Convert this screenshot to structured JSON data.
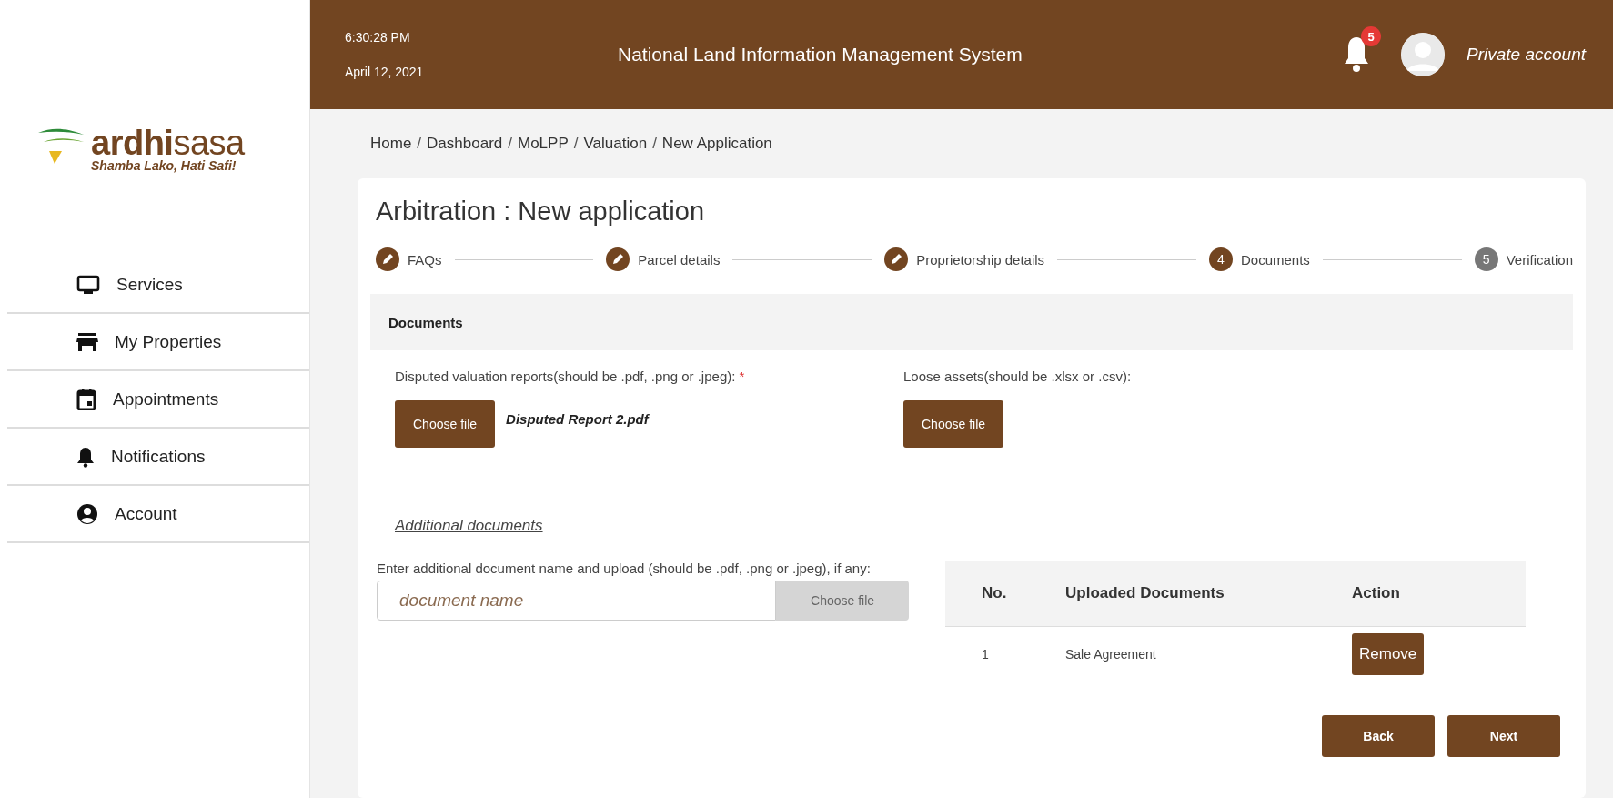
{
  "header": {
    "time": "6:30:28 PM",
    "date": "April 12, 2021",
    "title": "National Land Information Management System",
    "notification_count": "5",
    "account": "Private account"
  },
  "logo": {
    "name": "**ardhi**sasa",
    "tagline": "Shamba Lako, Hati Safi!"
  },
  "sidebar": {
    "items": [
      {
        "label": "Services",
        "kind": "monitor"
      },
      {
        "label": "My Properties",
        "kind": "store"
      },
      {
        "label": "Appointments",
        "kind": "calendar"
      },
      {
        "label": "Notifications",
        "kind": "bell"
      },
      {
        "label": "Account",
        "kind": "account"
      }
    ]
  },
  "breadcrumb": [
    "Home",
    "Dashboard",
    "MoLPP",
    "Valuation",
    "New Application"
  ],
  "breadcrumb_separator": "/",
  "page_title": "Arbitration : New application",
  "steps": [
    {
      "label": "FAQs",
      "kind": "done"
    },
    {
      "label": "Parcel details",
      "kind": "done"
    },
    {
      "label": "Proprietorship details",
      "kind": "done"
    },
    {
      "label": "Documents",
      "kind": "current",
      "number": "4"
    },
    {
      "label": "Verification",
      "kind": "pending",
      "number": "5"
    }
  ],
  "documents": {
    "heading": "Documents",
    "fields": [
      {
        "label": "Disputed valuation reports(should be .pdf, .png or .jpeg):",
        "required_mark": "*",
        "button": "Choose file",
        "file_name": "Disputed Report 2.pdf"
      },
      {
        "label": "Loose assets(should be .xlsx or .csv):",
        "button": "Choose file"
      }
    ]
  },
  "additional": {
    "link": "Additional documents",
    "instruction": "Enter additional document name and upload (should be .pdf, .png or .jpeg), if any:",
    "placeholder": "document name",
    "button": "Choose file"
  },
  "table": {
    "columns": [
      "No.",
      "Uploaded Documents",
      "Action"
    ],
    "rows": [
      {
        "no": "1",
        "document": "Sale Agreement",
        "action": "Remove"
      }
    ]
  },
  "buttons": [
    "Back",
    "Next"
  ]
}
